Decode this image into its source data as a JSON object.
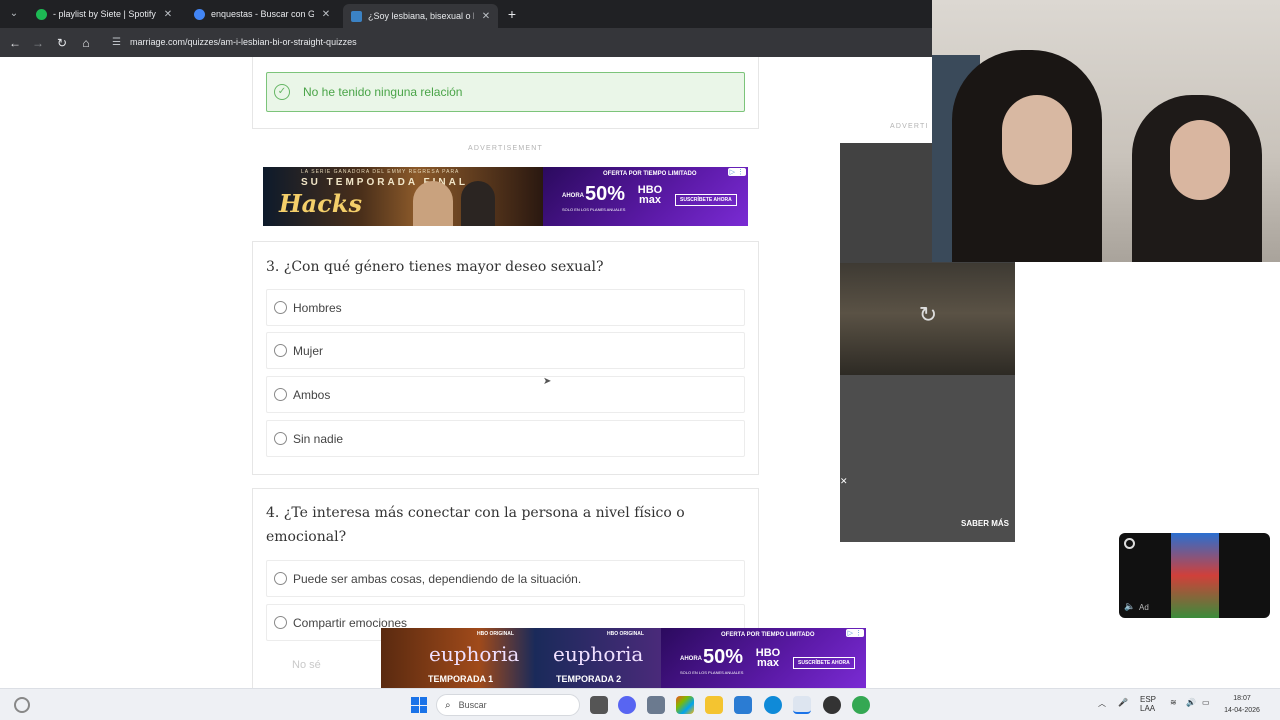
{
  "browser": {
    "tabs": [
      {
        "title": "- playlist by Siete | Spotify",
        "favicon_color": "#1db954"
      },
      {
        "title": "enquestas - Buscar con Google",
        "favicon_color": "#4285f4"
      },
      {
        "title": "¿Soy lesbiana, bisexual o heter…",
        "favicon_color": "#3b82c4"
      }
    ],
    "url": "marriage.com/quizzes/am-i-lesbian-bi-or-straight-quizzes"
  },
  "quiz": {
    "prev_selected_answer": "No he tenido ninguna relación",
    "advertisement_label": "ADVERTISEMENT",
    "q3": {
      "title": "3. ¿Con qué género tienes mayor deseo sexual?",
      "options": [
        "Hombres",
        "Mujer",
        "Ambos",
        "Sin nadie"
      ]
    },
    "q4": {
      "title_line1": "4. ¿Te interesa más conectar con la persona a nivel físico o",
      "title_line2": "emocional?",
      "options": [
        "Puede ser ambas cosas, dependiendo de la situación.",
        "Compartir emociones"
      ],
      "faded_option": "No sé"
    }
  },
  "ads": {
    "top_banner": {
      "series_caption": "LA SERIE GANADORA DEL EMMY REGRESA PARA",
      "season_text": "SU TEMPORADA FINAL",
      "show": "Hacks",
      "offer": "OFERTA POR TIEMPO LIMITADO",
      "prefix": "AHORA",
      "discount": "50%",
      "fine_print": "SOLO EN LOS PLANES ANUALES",
      "brand_line1": "HBO",
      "brand_line2": "max",
      "cta": "SUSCRÍBETE AHORA"
    },
    "bottom_banner": {
      "badge": "HBO ORIGINAL",
      "show": "euphoria",
      "season1": "TEMPORADA 1",
      "season2": "TEMPORADA 2",
      "offer": "OFERTA POR TIEMPO LIMITADO",
      "prefix": "AHORA",
      "discount": "50%",
      "fine_print": "SOLO EN LOS PLANES ANUALES",
      "brand_line1": "HBO",
      "brand_line2": "max",
      "cta": "SUSCRÍBETE AHORA"
    },
    "side_label": "ADVERTI",
    "video_cta": "SABER MÁS",
    "mini_player_tag": "Ad"
  },
  "taskbar": {
    "search_placeholder": "Buscar",
    "lang_line1": "ESP",
    "lang_line2": "LAA",
    "time": "18:07",
    "date": "14-04-2026"
  }
}
